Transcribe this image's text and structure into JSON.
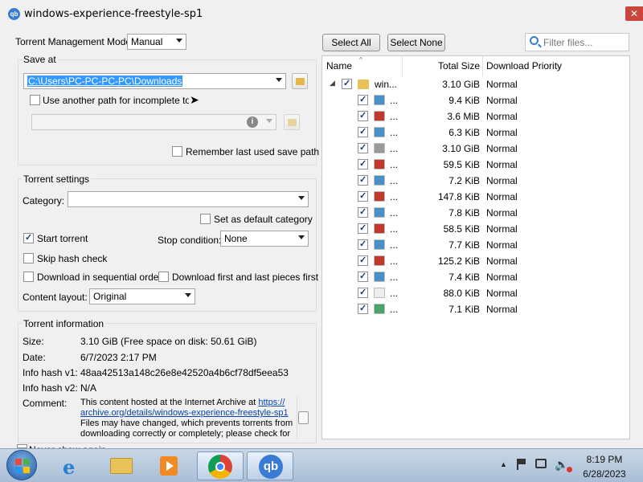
{
  "window": {
    "title": "windows-experience-freestyle-sp1",
    "app_icon_text": "qb",
    "close_glyph": "✕"
  },
  "mode": {
    "label": "Torrent Management Mode:",
    "value": "Manual"
  },
  "save_at": {
    "group_label": "Save at",
    "path": "C:\\Users\\PC-PC-PC-PC\\Downloads",
    "incomplete_label": "Use another path for incomplete torrents",
    "remember_label": "Remember last used save path"
  },
  "settings": {
    "group_label": "Torrent settings",
    "category_label": "Category:",
    "category_value": "",
    "default_category_label": "Set as default category",
    "start_torrent_label": "Start torrent",
    "stop_condition_label": "Stop condition:",
    "stop_condition_value": "None",
    "skip_hash_label": "Skip hash check",
    "sequential_label": "Download in sequential order",
    "first_last_label": "Download first and last pieces first",
    "content_layout_label": "Content layout:",
    "content_layout_value": "Original"
  },
  "info": {
    "group_label": "Torrent information",
    "size_label": "Size:",
    "size_value": "3.10 GiB (Free space on disk: 50.61 GiB)",
    "date_label": "Date:",
    "date_value": "6/7/2023 2:17 PM",
    "hash1_label": "Info hash v1:",
    "hash1_value": "48aa42513a148c26e8e42520a4b6cf78df5eea53",
    "hash2_label": "Info hash v2:",
    "hash2_value": "N/A",
    "comment_label": "Comment:",
    "comment_line1": "This content hosted at the Internet Archive at ",
    "comment_link1": "https://",
    "comment_link2": "archive.org/details/windows-experience-freestyle-sp1",
    "comment_line3": "Files may have changed, which prevents torrents from",
    "comment_line4": "downloading correctly or completely; please check for",
    "footer_partial": "Never show again"
  },
  "toolbar": {
    "select_all": "Select All",
    "select_none": "Select None",
    "filter_placeholder": "Filter files..."
  },
  "tree": {
    "columns": [
      "Name",
      "Total Size",
      "Download Priority"
    ],
    "root": {
      "name": "win...",
      "size": "3.10 GiB",
      "priority": "Normal"
    },
    "files": [
      {
        "name": "...",
        "size": "9.4 KiB",
        "priority": "Normal",
        "icon": "image-icon",
        "color": "#4a90c8"
      },
      {
        "name": "...",
        "size": "3.6 MiB",
        "priority": "Normal",
        "icon": "media-icon",
        "color": "#c0392b"
      },
      {
        "name": "...",
        "size": "6.3 KiB",
        "priority": "Normal",
        "icon": "image-icon",
        "color": "#4a90c8"
      },
      {
        "name": "...",
        "size": "3.10 GiB",
        "priority": "Normal",
        "icon": "disc-icon",
        "color": "#9a9a9a"
      },
      {
        "name": "...",
        "size": "59.5 KiB",
        "priority": "Normal",
        "icon": "media-icon",
        "color": "#c0392b"
      },
      {
        "name": "...",
        "size": "7.2 KiB",
        "priority": "Normal",
        "icon": "image-icon",
        "color": "#4a90c8"
      },
      {
        "name": "...",
        "size": "147.8 KiB",
        "priority": "Normal",
        "icon": "media-icon",
        "color": "#c0392b"
      },
      {
        "name": "...",
        "size": "7.8 KiB",
        "priority": "Normal",
        "icon": "image-icon",
        "color": "#4a90c8"
      },
      {
        "name": "...",
        "size": "58.5 KiB",
        "priority": "Normal",
        "icon": "media-icon",
        "color": "#c0392b"
      },
      {
        "name": "...",
        "size": "7.7 KiB",
        "priority": "Normal",
        "icon": "image-icon",
        "color": "#4a90c8"
      },
      {
        "name": "...",
        "size": "125.2 KiB",
        "priority": "Normal",
        "icon": "media-icon",
        "color": "#c0392b"
      },
      {
        "name": "...",
        "size": "7.4 KiB",
        "priority": "Normal",
        "icon": "image-icon",
        "color": "#4a90c8"
      },
      {
        "name": "...",
        "size": "88.0 KiB",
        "priority": "Normal",
        "icon": "blank-file-icon",
        "color": "#eeeeee"
      },
      {
        "name": "...",
        "size": "7.1 KiB",
        "priority": "Normal",
        "icon": "certificate-icon",
        "color": "#4aa36b"
      }
    ]
  },
  "taskbar": {
    "time": "8:19 PM",
    "date": "6/28/2023"
  }
}
